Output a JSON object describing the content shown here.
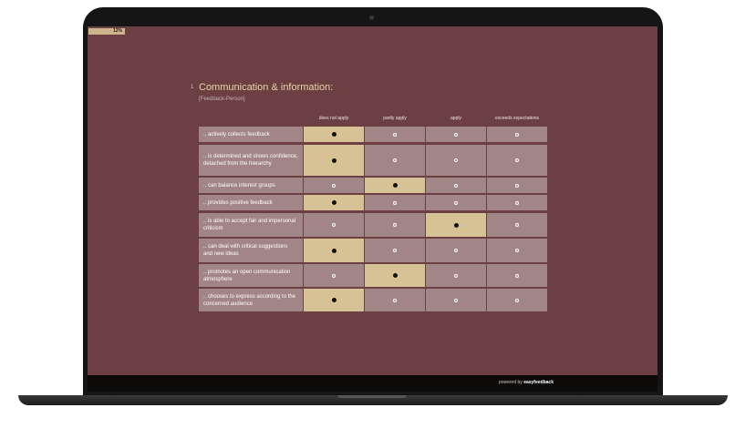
{
  "progress": {
    "label": "12%"
  },
  "question": {
    "number": "1",
    "title": "Communication & information:",
    "subtitle": "[Feedback-Person]"
  },
  "columns": [
    "does not apply",
    "partly apply",
    "apply",
    "exceeds expectations"
  ],
  "rows": [
    {
      "label": ".. actively collects feedback",
      "selected": 0
    },
    {
      "label": ".. is determined and shows confidence, detached from the hierarchy",
      "selected": 0
    },
    {
      "label": ".. can balance interest groups",
      "selected": 1
    },
    {
      "label": ".. provides positive feedback",
      "selected": 0
    },
    {
      "label": ".. is able to accept fair and impersonal criticism",
      "selected": 2
    },
    {
      "label": ".. can deal with critical suggestions and new ideas",
      "selected": 0
    },
    {
      "label": ".. promotes an open communication atmosphere",
      "selected": 1
    },
    {
      "label": ".. chooses to express according to the concerned audience",
      "selected": 0
    }
  ],
  "footer": {
    "powered_prefix": "powered by ",
    "brand": "easyfeedback"
  },
  "colors": {
    "background": "#6c3f43",
    "cell": "#a28587",
    "selected": "#d6c294",
    "title": "#e8d4a8"
  }
}
